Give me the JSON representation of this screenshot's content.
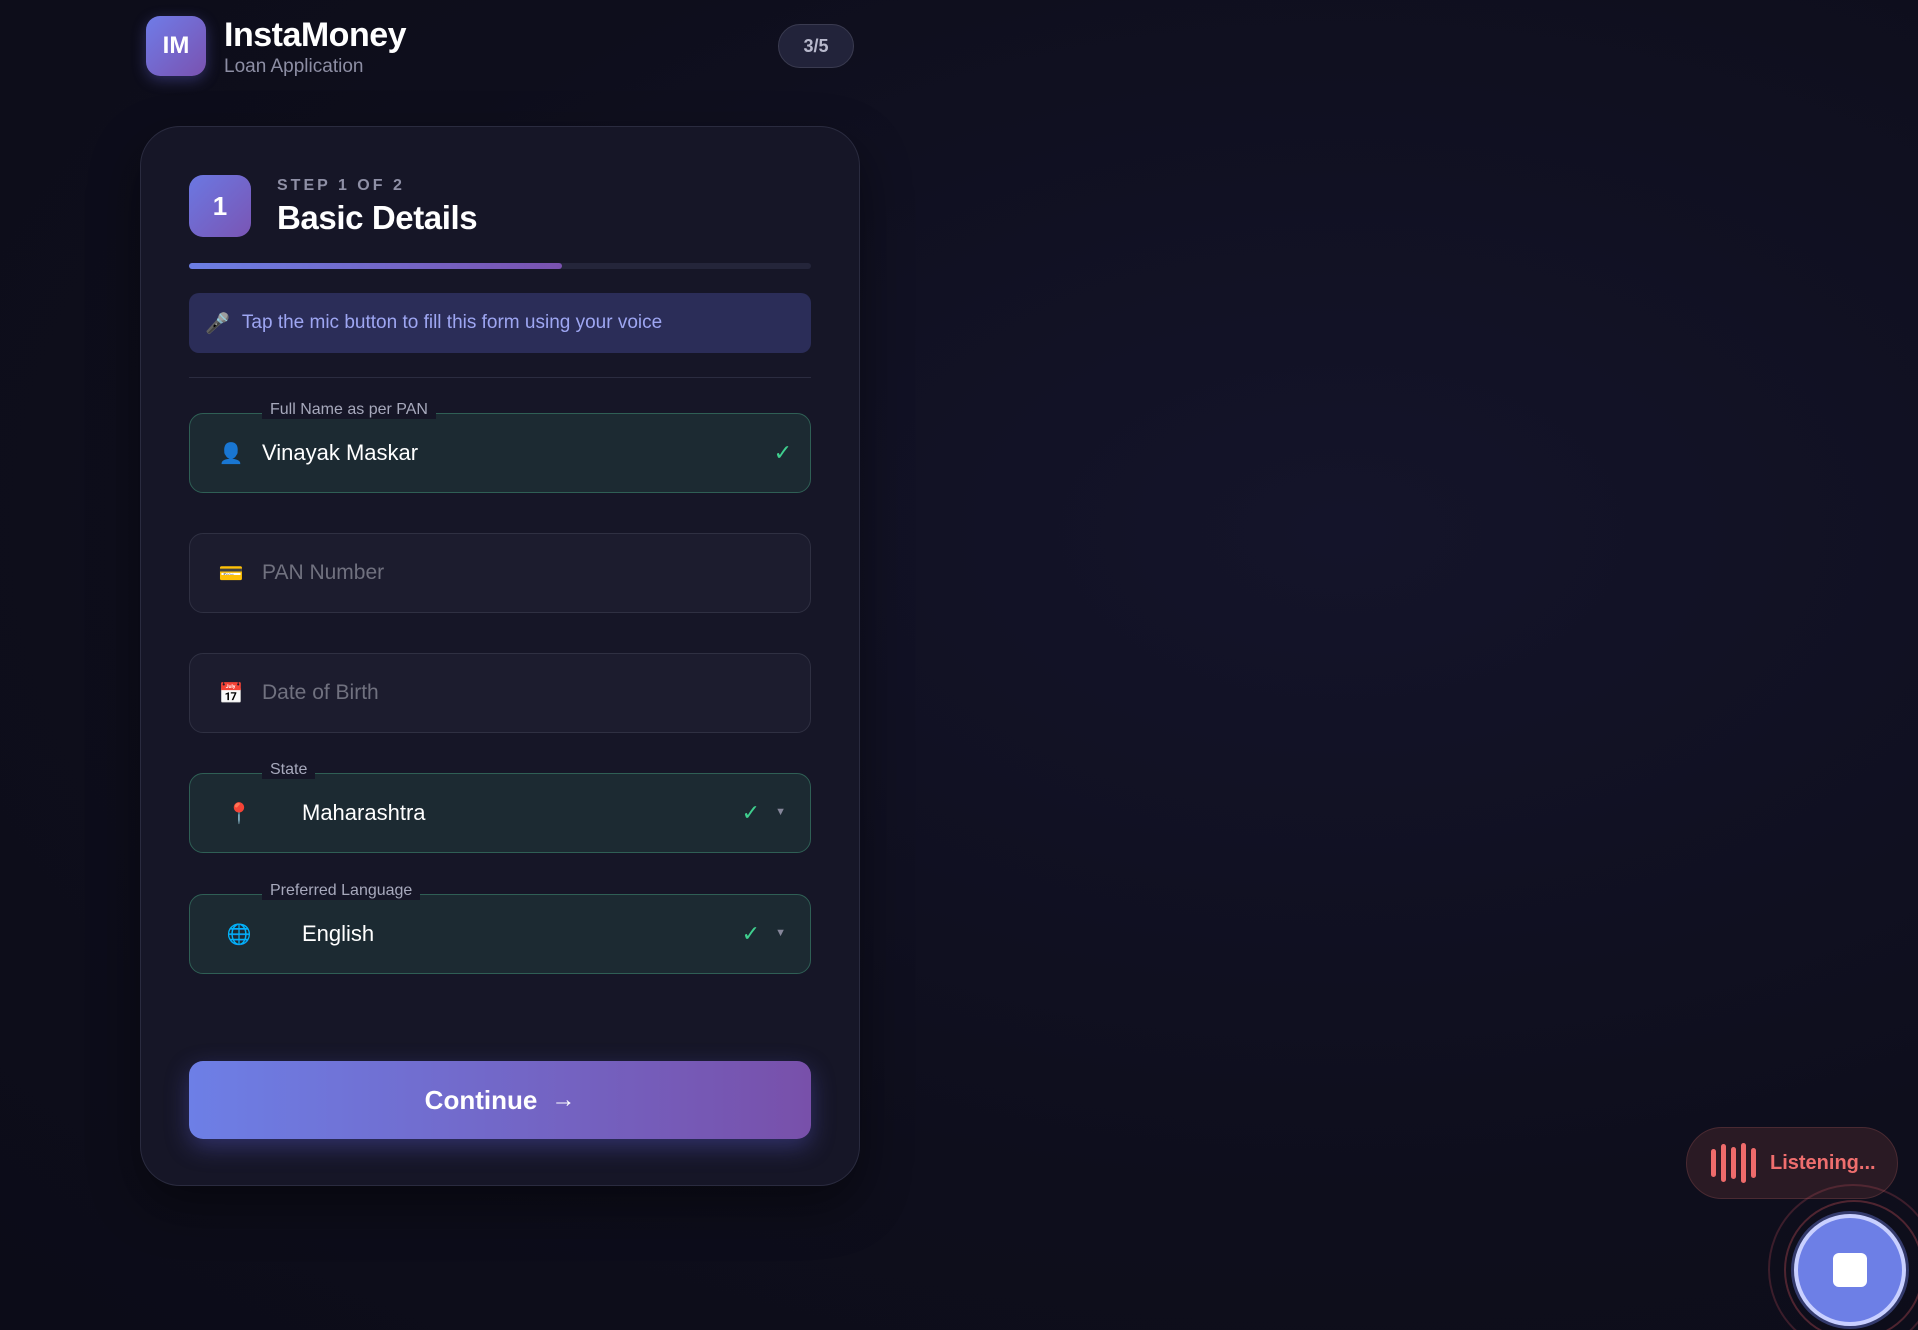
{
  "brand": {
    "logo_text": "IM",
    "title": "InstaMoney",
    "subtitle": "Loan Application",
    "step_counter": "3/5"
  },
  "step": {
    "number": "1",
    "label": "STEP 1 OF 2",
    "title": "Basic Details",
    "progress_fraction": 0.6
  },
  "voice_banner": {
    "icon": "microphone-icon",
    "text": "Tap the mic button to fill this form using your voice"
  },
  "fields": {
    "full_name": {
      "label": "Full Name as per PAN",
      "icon": "person-icon",
      "value": "Vinayak Maskar",
      "valid": true
    },
    "pan": {
      "icon": "card-icon",
      "placeholder": "PAN Number"
    },
    "dob": {
      "icon": "calendar-icon",
      "placeholder": "Date of Birth"
    },
    "state": {
      "label": "State",
      "icon": "pin-icon",
      "value": "Maharashtra",
      "valid": true
    },
    "language": {
      "label": "Preferred Language",
      "icon": "globe-icon",
      "value": "English",
      "valid": true
    }
  },
  "continue_button": {
    "label": "Continue",
    "arrow": "→"
  },
  "voice_status": {
    "text": "Listening..."
  },
  "colors": {
    "accent": "#6d7fe6",
    "accent_purple": "#7850aa",
    "success": "#3fcf8e",
    "listening": "#ef6e6e"
  }
}
